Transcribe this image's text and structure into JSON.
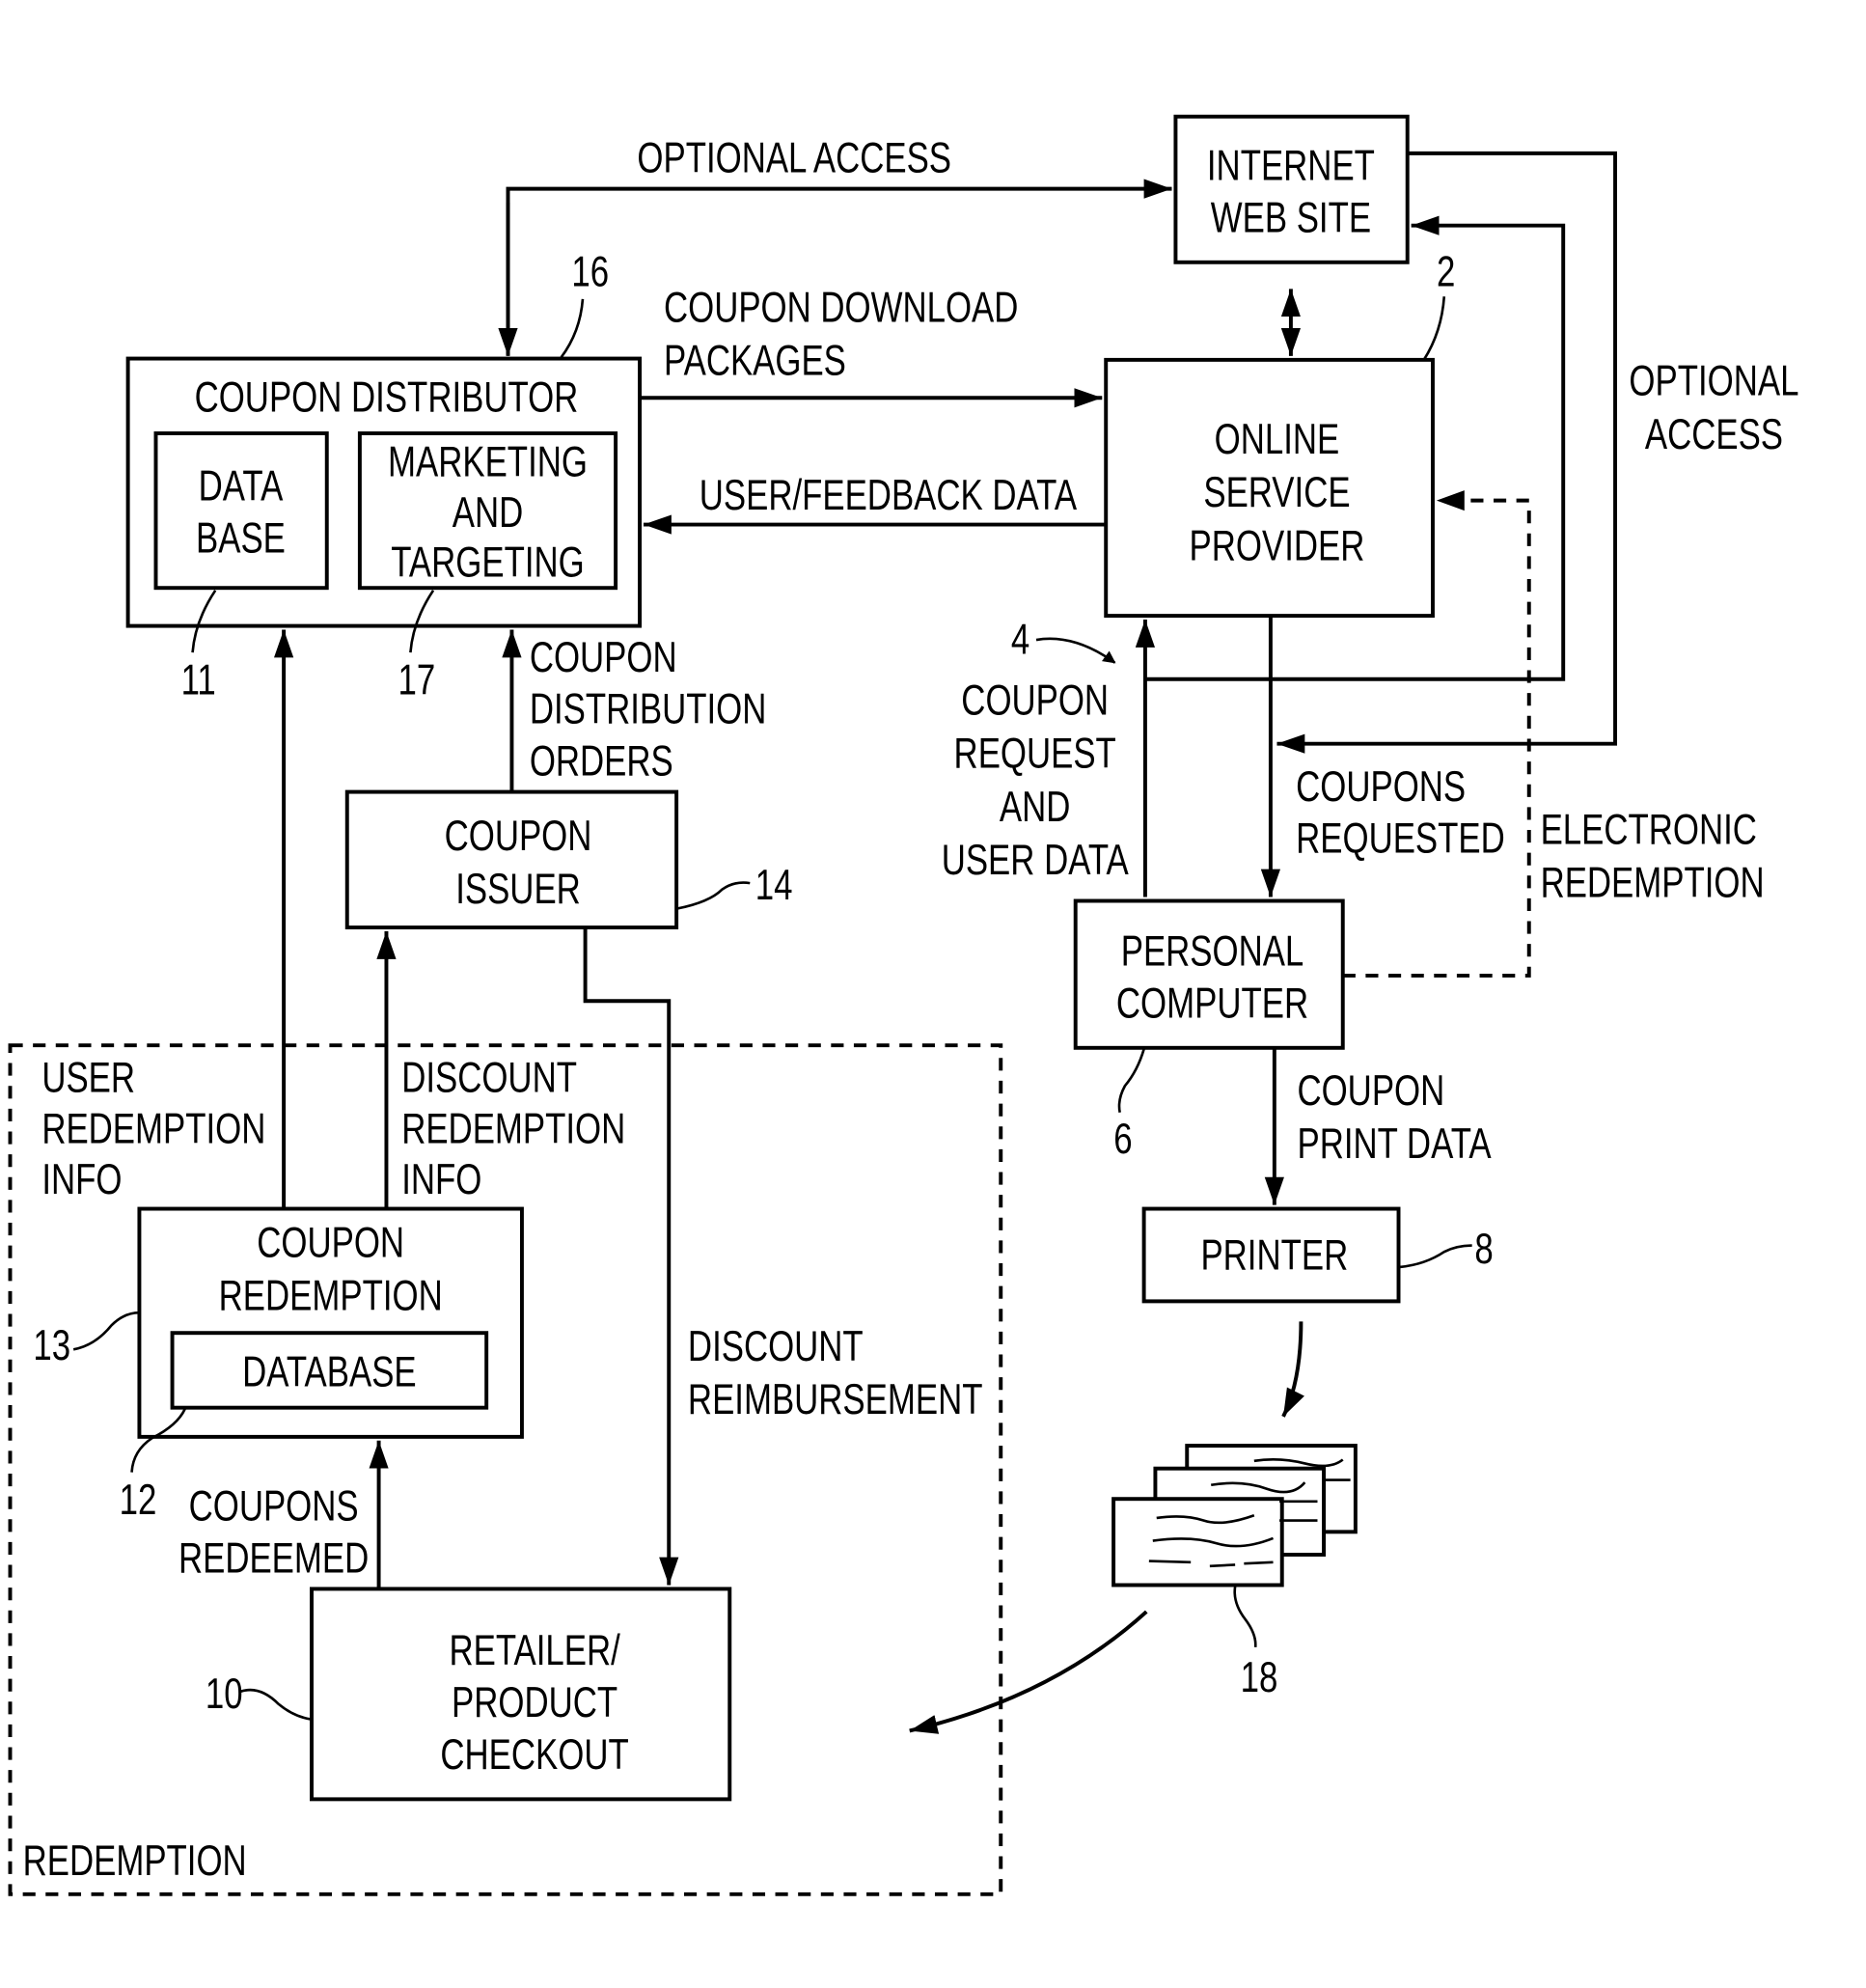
{
  "diagram": {
    "boxes": {
      "internet": [
        "INTERNET",
        "WEB SITE"
      ],
      "coupon_distributor": "COUPON DISTRIBUTOR",
      "data_base": [
        "DATA",
        "BASE"
      ],
      "marketing": [
        "MARKETING",
        "AND",
        "TARGETING"
      ],
      "online_service": [
        "ONLINE",
        "SERVICE",
        "PROVIDER"
      ],
      "coupon_issuer": [
        "COUPON",
        "ISSUER"
      ],
      "personal_computer": [
        "PERSONAL",
        "COMPUTER"
      ],
      "printer": "PRINTER",
      "coupon_redemption": [
        "COUPON",
        "REDEMPTION"
      ],
      "database": "DATABASE",
      "retailer": [
        "RETAILER/",
        "PRODUCT",
        "CHECKOUT"
      ]
    },
    "labels": {
      "optional_access_top": "OPTIONAL ACCESS",
      "coupon_download": [
        "COUPON DOWNLOAD",
        "PACKAGES"
      ],
      "user_feedback": "USER/FEEDBACK DATA",
      "optional_access_right": [
        "OPTIONAL",
        "ACCESS"
      ],
      "coupon_dist_orders": [
        "COUPON",
        "DISTRIBUTION",
        "ORDERS"
      ],
      "coupon_request": [
        "COUPON",
        "REQUEST",
        "AND",
        "USER DATA"
      ],
      "coupons_requested": [
        "COUPONS",
        "REQUESTED"
      ],
      "electronic_redemption": [
        "ELECTRONIC",
        "REDEMPTION"
      ],
      "coupon_print_data": [
        "COUPON",
        "PRINT DATA"
      ],
      "user_redemption_info": [
        "USER",
        "REDEMPTION",
        "INFO"
      ],
      "discount_redemption_info": [
        "DISCOUNT",
        "REDEMPTION",
        "INFO"
      ],
      "discount_reimbursement": [
        "DISCOUNT",
        "REIMBURSEMENT"
      ],
      "coupons_redeemed": [
        "COUPONS",
        "REDEEMED"
      ],
      "redemption_region": "REDEMPTION"
    },
    "refs": {
      "r2": "2",
      "r4": "4",
      "r6": "6",
      "r8": "8",
      "r10": "10",
      "r11": "11",
      "r12": "12",
      "r13": "13",
      "r14": "14",
      "r16": "16",
      "r17": "17",
      "r18": "18"
    }
  }
}
